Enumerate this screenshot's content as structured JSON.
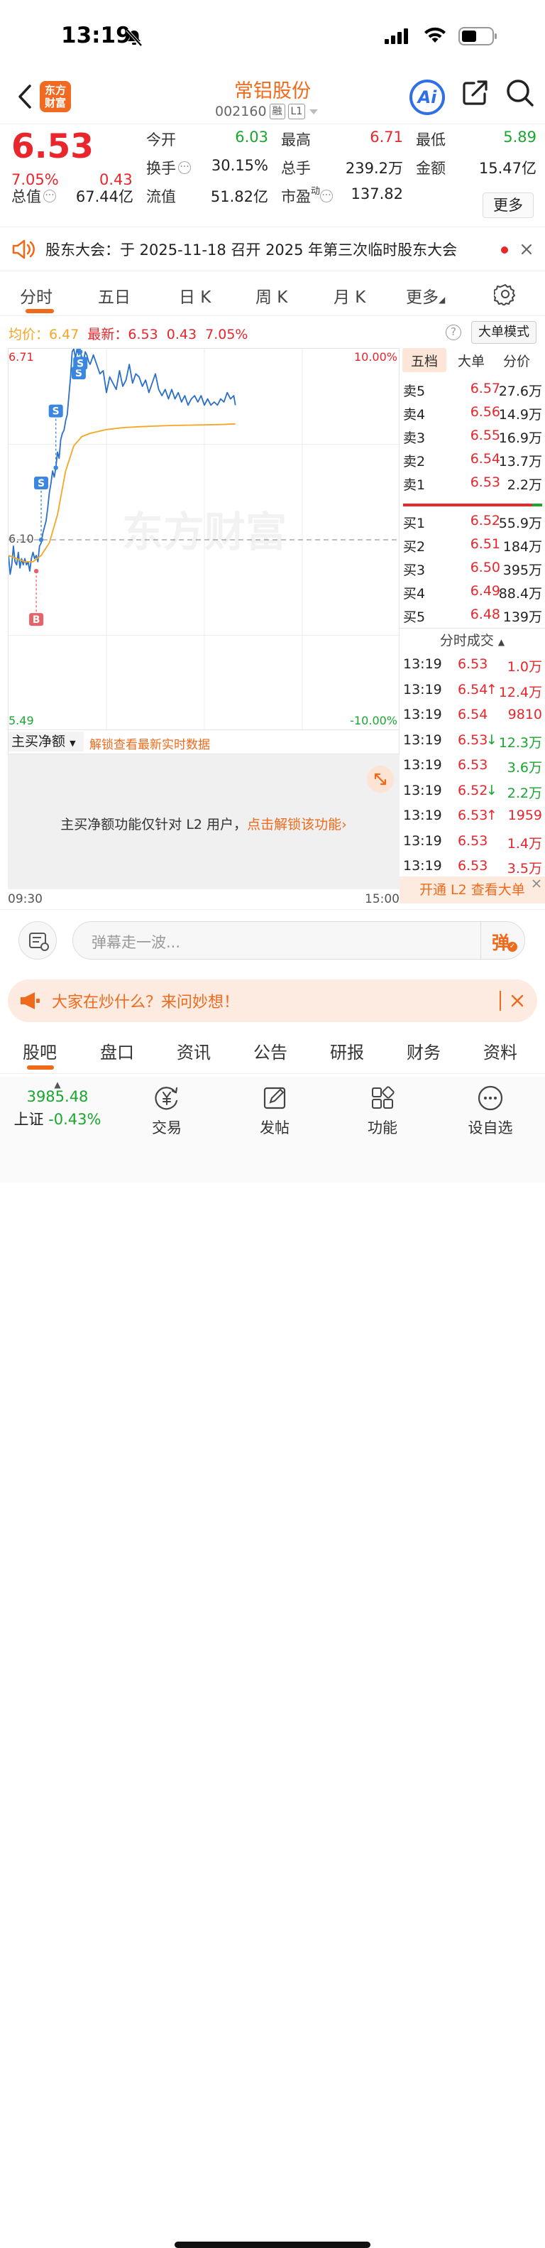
{
  "status_bar": {
    "time": "13:19"
  },
  "header": {
    "logo_text_1": "东方",
    "logo_text_2": "财富",
    "stock_name": "常铝股份",
    "stock_code": "002160",
    "tag_margin": "融",
    "tag_level": "L1",
    "ai_label": "Ai"
  },
  "quote": {
    "price": "6.53",
    "change_pct": "7.05%",
    "change_amt": "0.43",
    "open_label": "今开",
    "open_value": "6.03",
    "high_label": "最高",
    "high_value": "6.71",
    "low_label": "最低",
    "low_value": "5.89",
    "turnover_label": "换手",
    "turnover_value": "30.15%",
    "volume_label": "总手",
    "volume_value": "239.2万",
    "amount_label": "金额",
    "amount_value": "15.47亿",
    "mktcap_label": "总值",
    "mktcap_value": "67.44亿",
    "float_label": "流值",
    "float_value": "51.82亿",
    "pe_label": "市盈",
    "pe_sup": "动",
    "pe_value": "137.82",
    "more_label": "更多"
  },
  "notice": {
    "text": "股东大会：于 2025-11-18 召开 2025 年第三次临时股东大会"
  },
  "chart_tabs": [
    "分时",
    "五日",
    "日 K",
    "周 K",
    "月 K",
    "更多"
  ],
  "chart_info": {
    "avg_label": "均价：",
    "avg_value": "6.47",
    "latest_label": "最新：",
    "latest_value": "6.53",
    "change_amt": "0.43",
    "change_pct": "7.05%",
    "help_icon": "?",
    "big_order_mode": "大单模式"
  },
  "chart_data": {
    "type": "line",
    "y_top_label": "6.71",
    "y_mid_label": "6.10",
    "y_bottom_label": "5.49",
    "pct_top_label": "10.00%",
    "pct_bottom_label": "-10.00%",
    "ylim": [
      5.49,
      6.71
    ],
    "prev_close": 6.1,
    "x_start_label": "09:30",
    "x_end_label": "15:00",
    "watermark": "东方财富",
    "total_minutes": 240,
    "series": [
      {
        "name": "最新",
        "x": [
          0,
          1,
          2,
          3,
          4,
          5,
          6,
          7,
          8,
          9,
          10,
          11,
          12,
          13,
          14,
          15,
          16,
          17,
          18,
          19,
          20,
          21,
          22,
          23,
          24,
          25,
          26,
          27,
          28,
          29,
          30,
          31,
          32,
          33,
          34,
          35,
          36,
          37,
          38,
          39,
          40,
          41,
          42,
          43,
          44,
          45,
          46,
          47,
          48,
          49,
          50,
          52,
          54,
          56,
          58,
          60,
          62,
          64,
          66,
          68,
          70,
          72,
          74,
          76,
          78,
          80,
          82,
          84,
          86,
          88,
          90,
          92,
          94,
          96,
          98,
          100,
          102,
          104,
          106,
          108,
          110,
          112,
          114,
          116,
          118,
          120,
          122,
          124,
          126,
          128,
          130,
          132,
          134,
          136,
          138,
          139
        ],
        "values": [
          6.05,
          5.99,
          6.02,
          6.08,
          6.03,
          6.02,
          6.06,
          6.01,
          6.04,
          6.02,
          6.04,
          6.02,
          6.03,
          6.0,
          6.04,
          6.06,
          6.04,
          6.05,
          6.03,
          6.08,
          6.09,
          6.12,
          6.14,
          6.16,
          6.2,
          6.25,
          6.28,
          6.32,
          6.3,
          6.33,
          6.38,
          6.36,
          6.42,
          6.44,
          6.45,
          6.48,
          6.5,
          6.56,
          6.62,
          6.7,
          6.71,
          6.68,
          6.71,
          6.69,
          6.7,
          6.68,
          6.67,
          6.7,
          6.69,
          6.67,
          6.66,
          6.69,
          6.66,
          6.63,
          6.64,
          6.57,
          6.62,
          6.6,
          6.58,
          6.64,
          6.59,
          6.61,
          6.66,
          6.6,
          6.63,
          6.62,
          6.59,
          6.61,
          6.57,
          6.6,
          6.63,
          6.58,
          6.56,
          6.58,
          6.55,
          6.58,
          6.55,
          6.57,
          6.54,
          6.56,
          6.53,
          6.55,
          6.56,
          6.54,
          6.56,
          6.53,
          6.55,
          6.53,
          6.54,
          6.53,
          6.55,
          6.54,
          6.57,
          6.55,
          6.56,
          6.53
        ]
      },
      {
        "name": "均价",
        "x": [
          0,
          5,
          10,
          15,
          20,
          25,
          30,
          35,
          40,
          45,
          50,
          60,
          70,
          80,
          90,
          100,
          110,
          120,
          130,
          139
        ],
        "values": [
          6.05,
          6.04,
          6.03,
          6.03,
          6.05,
          6.09,
          6.18,
          6.32,
          6.4,
          6.43,
          6.44,
          6.452,
          6.458,
          6.461,
          6.463,
          6.465,
          6.466,
          6.467,
          6.468,
          6.47
        ]
      }
    ]
  },
  "trade_marks": [
    {
      "label": "B",
      "x": 17,
      "price": 6.0
    },
    {
      "label": "S",
      "x": 20,
      "price": 6.1
    },
    {
      "label": "S",
      "x": 29,
      "price": 6.33
    },
    {
      "label": "S",
      "x": 43,
      "price": 6.71
    },
    {
      "label": "S",
      "x": 44,
      "price": 6.7
    }
  ],
  "order_book": {
    "tabs": [
      "五档",
      "大单",
      "分价"
    ],
    "asks": [
      {
        "label": "卖5",
        "price": "6.57",
        "vol": "27.6万"
      },
      {
        "label": "卖4",
        "price": "6.56",
        "vol": "14.9万"
      },
      {
        "label": "卖3",
        "price": "6.55",
        "vol": "16.9万"
      },
      {
        "label": "卖2",
        "price": "6.54",
        "vol": "13.7万"
      },
      {
        "label": "卖1",
        "price": "6.53",
        "vol": "2.2万"
      }
    ],
    "bids": [
      {
        "label": "买1",
        "price": "6.52",
        "vol": "55.9万"
      },
      {
        "label": "买2",
        "price": "6.51",
        "vol": "184万"
      },
      {
        "label": "买3",
        "price": "6.50",
        "vol": "395万"
      },
      {
        "label": "买4",
        "price": "6.49",
        "vol": "88.4万"
      },
      {
        "label": "买5",
        "price": "6.48",
        "vol": "139万"
      }
    ],
    "trades_header": "分时成交",
    "trades": [
      {
        "time": "13:19",
        "price": "6.53",
        "arrow": "",
        "vol": "1.0万",
        "dir": "buy"
      },
      {
        "time": "13:19",
        "price": "6.54",
        "arrow": "↑",
        "vol": "12.4万",
        "dir": "buy"
      },
      {
        "time": "13:19",
        "price": "6.54",
        "arrow": "",
        "vol": "9810",
        "dir": "buy"
      },
      {
        "time": "13:19",
        "price": "6.53",
        "arrow": "↓",
        "vol": "12.3万",
        "dir": "sell"
      },
      {
        "time": "13:19",
        "price": "6.53",
        "arrow": "",
        "vol": "3.6万",
        "dir": "sell"
      },
      {
        "time": "13:19",
        "price": "6.52",
        "arrow": "↓",
        "vol": "2.2万",
        "dir": "sell"
      },
      {
        "time": "13:19",
        "price": "6.53",
        "arrow": "↑",
        "vol": "1959",
        "dir": "buy"
      },
      {
        "time": "13:19",
        "price": "6.53",
        "arrow": "",
        "vol": "1.4万",
        "dir": "buy"
      },
      {
        "time": "13:19",
        "price": "6.53",
        "arrow": "",
        "vol": "3.5万",
        "dir": "buy"
      }
    ],
    "open_l2": "开通 L2 查看大单"
  },
  "net_buy": {
    "selector": "主买净额",
    "unlock_hint": "解锁查看最新实时数据",
    "message": "主买净额功能仅针对 L2 用户，",
    "link": "点击解锁该功能"
  },
  "comment": {
    "placeholder": "弹幕走一波...",
    "danmu_label": "弹"
  },
  "banner": {
    "text": "大家在炒什么？来问妙想！"
  },
  "bottom_tabs": [
    "股吧",
    "盘口",
    "资讯",
    "公告",
    "研报",
    "财务",
    "资料"
  ],
  "nav": {
    "index_value": "3985.48",
    "index_name": "上证",
    "index_change": "-0.43%",
    "items": [
      "交易",
      "发帖",
      "功能",
      "设自选"
    ]
  },
  "colors": {
    "up": "#e8262b",
    "down": "#1aa62f",
    "accent": "#f06a1c",
    "price_line": "#2a6fc9",
    "avg_line": "#f5a623"
  }
}
